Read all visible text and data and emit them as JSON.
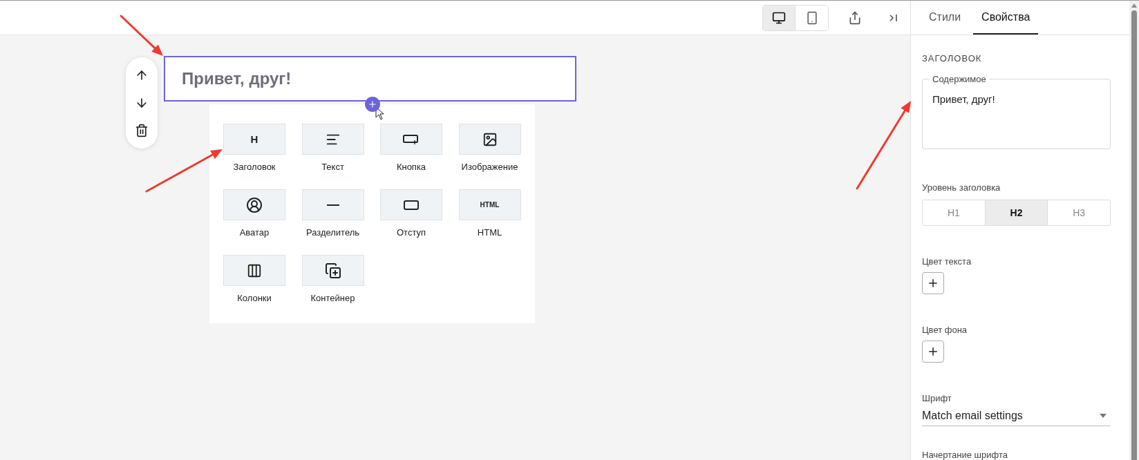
{
  "toolbar": {
    "devices": [
      {
        "kind": "desktop",
        "selected": true
      },
      {
        "kind": "mobile",
        "selected": false
      }
    ]
  },
  "canvas": {
    "heading_block": {
      "text": "Привет, друг!",
      "selected": true
    },
    "block_menu": [
      {
        "kind": "heading",
        "label": "Заголовок",
        "glyph": "H"
      },
      {
        "kind": "text",
        "label": "Текст"
      },
      {
        "kind": "button",
        "label": "Кнопка"
      },
      {
        "kind": "image",
        "label": "Изображение"
      },
      {
        "kind": "avatar",
        "label": "Аватар"
      },
      {
        "kind": "divider",
        "label": "Разделитель"
      },
      {
        "kind": "spacer",
        "label": "Отступ"
      },
      {
        "kind": "html",
        "label": "HTML",
        "glyph": "HTML"
      },
      {
        "kind": "columns",
        "label": "Колонки"
      },
      {
        "kind": "container",
        "label": "Контейнер"
      }
    ]
  },
  "panel": {
    "tabs": [
      {
        "label": "Стили",
        "selected": false
      },
      {
        "label": "Свойства",
        "selected": true
      }
    ],
    "section_title": "ЗАГОЛОВОК",
    "content_field": {
      "label": "Содержимое",
      "value": "Привет, друг!"
    },
    "heading_level": {
      "label": "Уровень заголовка",
      "options": [
        {
          "label": "H1",
          "selected": false
        },
        {
          "label": "H2",
          "selected": true
        },
        {
          "label": "H3",
          "selected": false
        }
      ]
    },
    "text_color": {
      "label": "Цвет текста"
    },
    "background_color": {
      "label": "Цвет фона"
    },
    "font": {
      "label": "Шрифт",
      "value": "Match email settings"
    },
    "font_style": {
      "label": "Начертание шрифта"
    }
  }
}
